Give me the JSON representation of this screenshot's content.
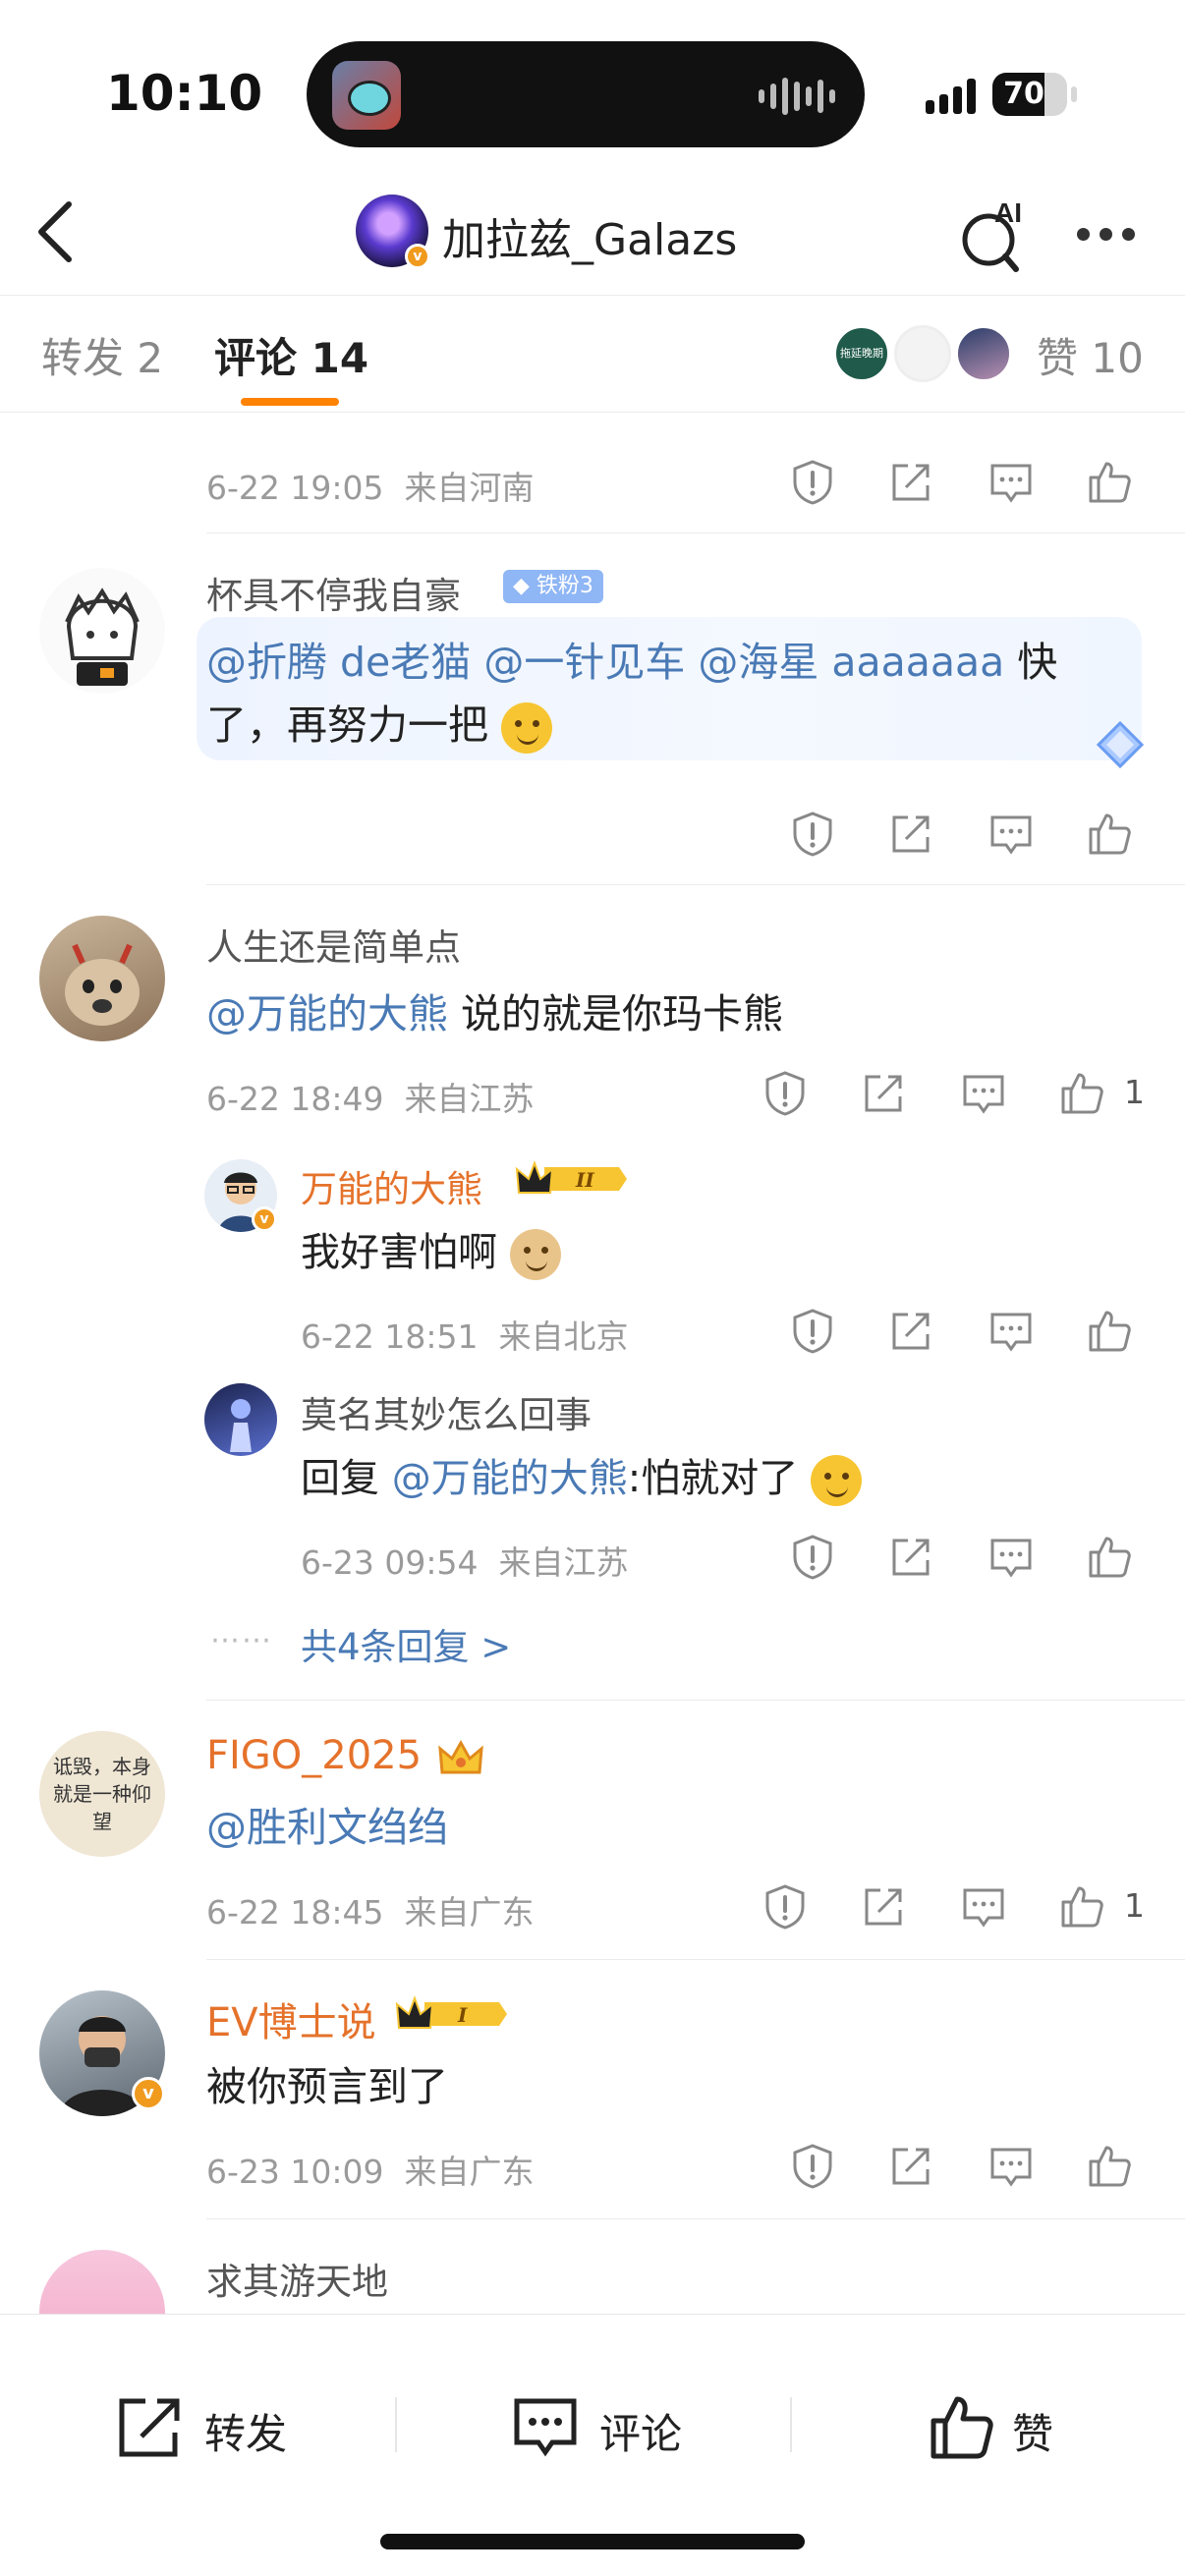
{
  "status": {
    "time": "10:10",
    "battery": "70",
    "battery_level_percent": 70
  },
  "nav": {
    "title": "加拉兹_Galazs",
    "ai_label": "AI"
  },
  "tabs": {
    "repost": "转发 2",
    "comments": "评论 14",
    "likes": "赞 10",
    "liker_avatar_text": "拖延晚期"
  },
  "comments": [
    {
      "time": "6-22 19:05",
      "location": "来自河南"
    },
    {
      "name": "杯具不停我自豪",
      "fan_badge": "铁粉3",
      "text_mentions": "@折腾 de老猫 @一针见车 @海星 aaaaaaa",
      "text_line1_tail": " 快",
      "text_line2": "了，再努力一把"
    },
    {
      "name": "人生还是简单点",
      "mention": "@万能的大熊",
      "text": " 说的就是你玛卡熊",
      "time": "6-22 18:49",
      "location": "来自江苏",
      "likes": "1"
    },
    {
      "name": "万能的大熊",
      "crown_level": "II",
      "text": "我好害怕啊",
      "time": "6-22 18:51",
      "location": "来自北京"
    },
    {
      "name": "莫名其妙怎么回事",
      "prefix": "回复 ",
      "mention": "@万能的大熊",
      "text": ":怕就对了",
      "time": "6-23 09:54",
      "location": "来自江苏"
    },
    {
      "name": "FIGO_2025",
      "mention": "@胜利文绉绉",
      "time": "6-22 18:45",
      "location": "来自广东",
      "likes": "1"
    },
    {
      "name": "EV博士说",
      "crown_level": "I",
      "text": "被你预言到了",
      "time": "6-23 10:09",
      "location": "来自广东"
    },
    {
      "name": "求其游天地"
    }
  ],
  "more_replies": "共4条回复 >",
  "more_dots": "⋯⋯",
  "avatar_texts": {
    "figo": "诋毁，本身就是一种仰望"
  },
  "bottom": {
    "repost": "转发",
    "comment": "评论",
    "like": "赞"
  },
  "colors": {
    "accent": "#ff8200",
    "link": "#4a7ab5",
    "vip_name": "#e5722b"
  }
}
